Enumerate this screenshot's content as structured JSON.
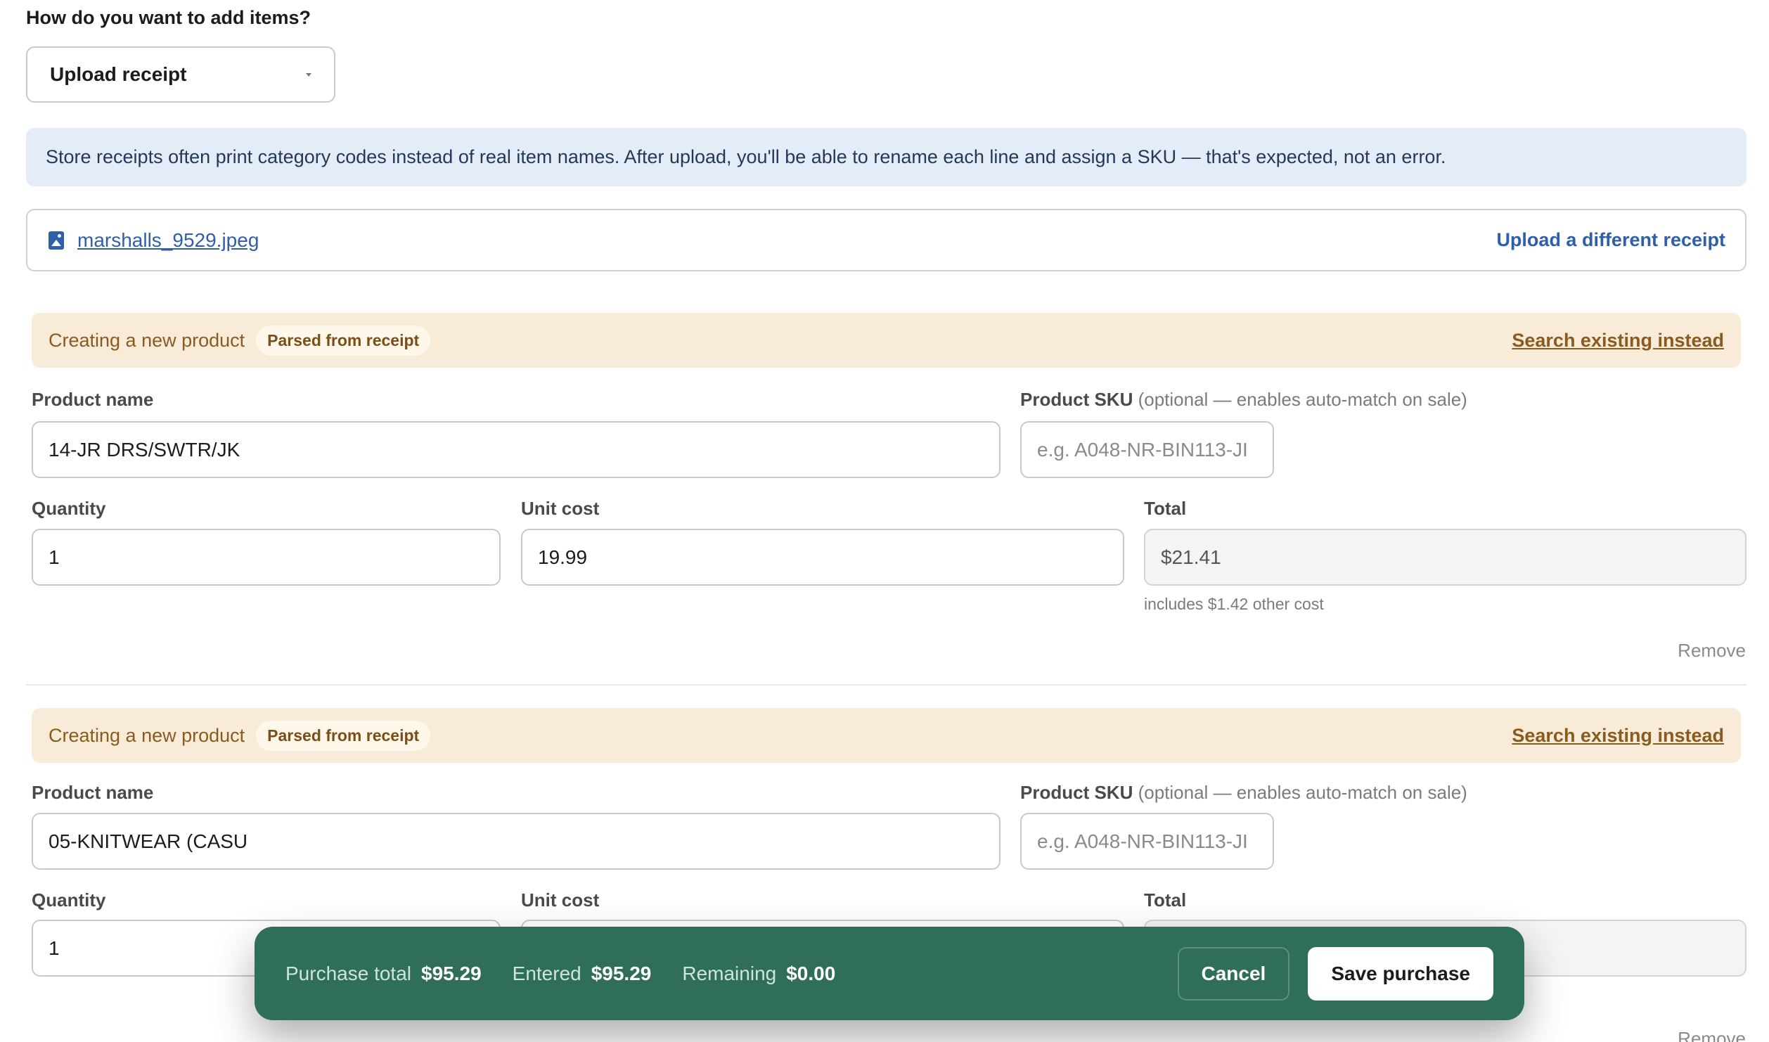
{
  "page": {
    "question": "How do you want to add items?",
    "method_select_value": "Upload receipt",
    "info_banner": "Store receipts often print category codes instead of real item names. After upload, you'll be able to rename each line and assign a SKU — that's expected, not an error.",
    "file_name": "marshalls_9529.jpeg",
    "upload_different_label": "Upload a different receipt"
  },
  "labels": {
    "creating_new": "Creating a new product",
    "parsed_badge": "Parsed from receipt",
    "search_existing": "Search existing instead",
    "product_name": "Product name",
    "product_sku": "Product SKU",
    "sku_hint": "(optional — enables auto-match on sale)",
    "sku_placeholder": "e.g. A048-NR-BIN113-JI",
    "quantity": "Quantity",
    "unit_cost": "Unit cost",
    "total": "Total",
    "remove": "Remove"
  },
  "items": [
    {
      "product_name": "14-JR DRS/SWTR/JK",
      "sku": "",
      "quantity": "1",
      "unit_cost": "19.99",
      "total": "$21.41",
      "total_note": "includes $1.42 other cost"
    },
    {
      "product_name": "05-KNITWEAR (CASU",
      "sku": "",
      "quantity": "1",
      "unit_cost": "",
      "total": "",
      "total_note": ""
    }
  ],
  "footer": {
    "purchase_total_label": "Purchase total",
    "purchase_total_value": "$95.29",
    "entered_label": "Entered",
    "entered_value": "$95.29",
    "remaining_label": "Remaining",
    "remaining_value": "$0.00",
    "cancel_label": "Cancel",
    "save_label": "Save purchase"
  },
  "colors": {
    "accent_blue": "#2f5fa8",
    "footer_green": "#2f6e58",
    "warning_bg": "#f8ecd9",
    "warning_text": "#8a5a1e",
    "info_bg": "#e4ecf7"
  }
}
